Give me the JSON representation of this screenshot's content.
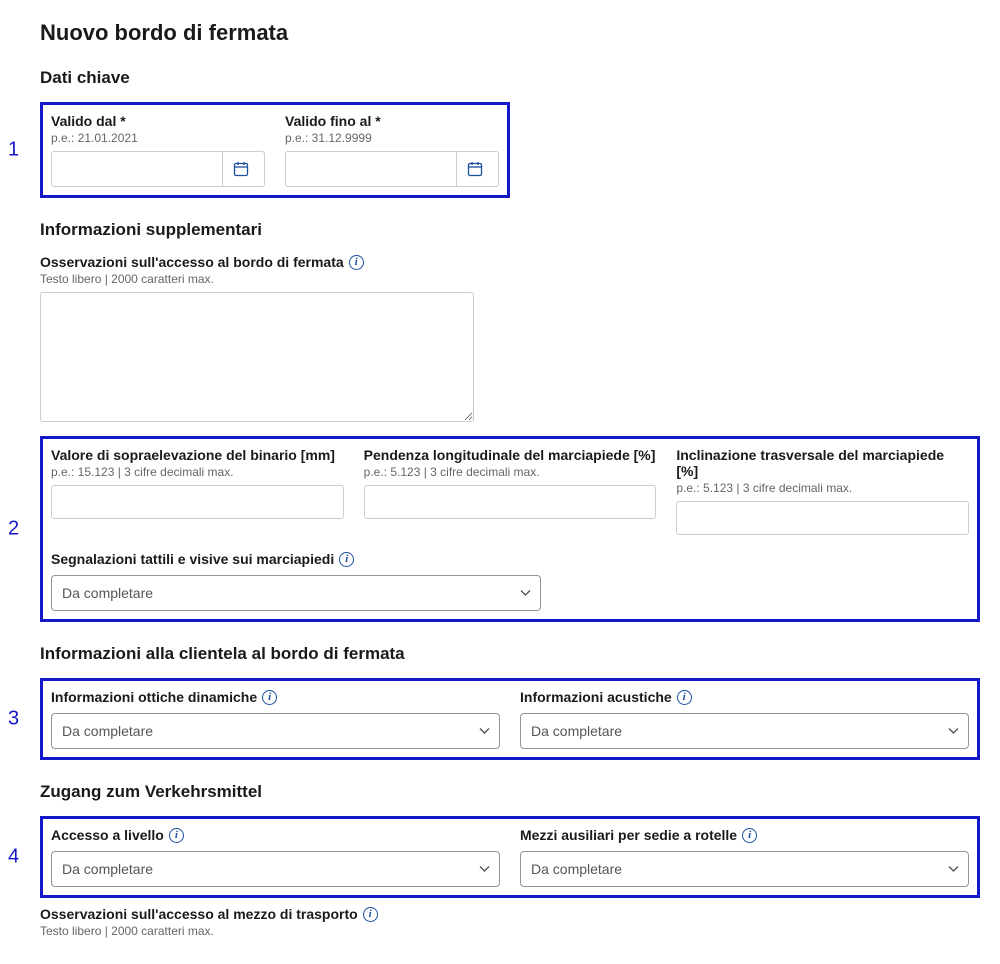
{
  "title": "Nuovo bordo di fermata",
  "annotations": {
    "a1": "1",
    "a2": "2",
    "a3": "3",
    "a4": "4"
  },
  "sections": {
    "datiChiave": {
      "title": "Dati chiave",
      "validoDal": {
        "label": "Valido dal *",
        "hint": "p.e.: 21.01.2021",
        "value": ""
      },
      "validoFinoAl": {
        "label": "Valido fino al *",
        "hint": "p.e.: 31.12.9999",
        "value": ""
      }
    },
    "infoSupp": {
      "title": "Informazioni supplementari",
      "osservazioni": {
        "label": "Osservazioni sull'accesso al bordo di fermata",
        "hint": "Testo libero | 2000 caratteri max.",
        "value": ""
      },
      "sopraelevazione": {
        "label": "Valore di sopraelevazione del binario [mm]",
        "hint": "p.e.: 15.123 | 3 cifre decimali max.",
        "value": ""
      },
      "pendenzaLong": {
        "label": "Pendenza longitudinale del marciapiede [%]",
        "hint": "p.e.: 5.123 | 3 cifre decimali max.",
        "value": ""
      },
      "inclinazioneTrasv": {
        "label": "Inclinazione trasversale del marciapiede [%]",
        "hint": "p.e.: 5.123 | 3 cifre decimali max.",
        "value": ""
      },
      "segnalazioni": {
        "label": "Segnalazioni tattili e visive sui marciapiedi",
        "value": "Da completare"
      }
    },
    "infoClientela": {
      "title": "Informazioni alla clientela al bordo di fermata",
      "otticheDinamiche": {
        "label": "Informazioni ottiche dinamiche",
        "value": "Da completare"
      },
      "acustiche": {
        "label": "Informazioni acustiche",
        "value": "Da completare"
      }
    },
    "zugang": {
      "title": "Zugang zum Verkehrsmittel",
      "accessoLivello": {
        "label": "Accesso a livello",
        "value": "Da completare"
      },
      "mezziAusiliari": {
        "label": "Mezzi ausiliari per sedie a rotelle",
        "value": "Da completare"
      },
      "osservazioniMezzo": {
        "label": "Osservazioni sull'accesso al mezzo di trasporto",
        "hint": "Testo libero | 2000 caratteri max."
      }
    }
  }
}
